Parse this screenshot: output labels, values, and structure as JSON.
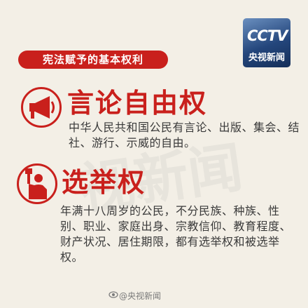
{
  "header": {
    "label": "宪法赋予的基本权利"
  },
  "logo": {
    "mark": "CCTV",
    "name": "央视新闻"
  },
  "sections": [
    {
      "icon": "megaphone-icon",
      "title": "言论自由权",
      "body": "中华人民共和国公民有言论、出版、集会、结社、游行、示威的自由。"
    },
    {
      "icon": "voter-raising-ballot-icon",
      "title": "选举权",
      "body": "年满十八周岁的公民，不分民族、种族、性别、职业、家庭出身、宗教信仰、教育程度、财产状况、居住期限，都有选举权和被选举权。"
    }
  ],
  "watermark": {
    "text": "视新闻"
  },
  "footer": {
    "credit": "@央视新闻"
  },
  "colors": {
    "accent": "#c9201c",
    "background": "#f3efe6",
    "body_text": "#3a3a3a",
    "logo_blue": "#24467c"
  }
}
